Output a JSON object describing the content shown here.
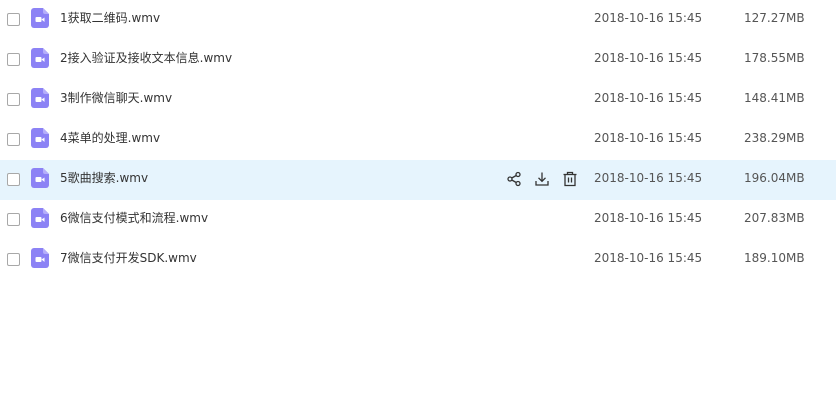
{
  "colors": {
    "hover_row_bg": "#e6f4fd",
    "video_icon": "#8c82f5",
    "action_icon": "#333333"
  },
  "actions": {
    "share_icon": "share-icon",
    "download_icon": "download-icon",
    "delete_icon": "trash-icon"
  },
  "files": [
    {
      "name": "1获取二维码.wmv",
      "date": "2018-10-16 15:45",
      "size": "127.27MB",
      "icon": "video-file-icon"
    },
    {
      "name": "2接入验证及接收文本信息.wmv",
      "date": "2018-10-16 15:45",
      "size": "178.55MB",
      "icon": "video-file-icon"
    },
    {
      "name": "3制作微信聊天.wmv",
      "date": "2018-10-16 15:45",
      "size": "148.41MB",
      "icon": "video-file-icon"
    },
    {
      "name": "4菜单的处理.wmv",
      "date": "2018-10-16 15:45",
      "size": "238.29MB",
      "icon": "video-file-icon"
    },
    {
      "name": "5歌曲搜索.wmv",
      "date": "2018-10-16 15:45",
      "size": "196.04MB",
      "icon": "video-file-icon"
    },
    {
      "name": "6微信支付模式和流程.wmv",
      "date": "2018-10-16 15:45",
      "size": "207.83MB",
      "icon": "video-file-icon"
    },
    {
      "name": "7微信支付开发SDK.wmv",
      "date": "2018-10-16 15:45",
      "size": "189.10MB",
      "icon": "video-file-icon"
    }
  ]
}
